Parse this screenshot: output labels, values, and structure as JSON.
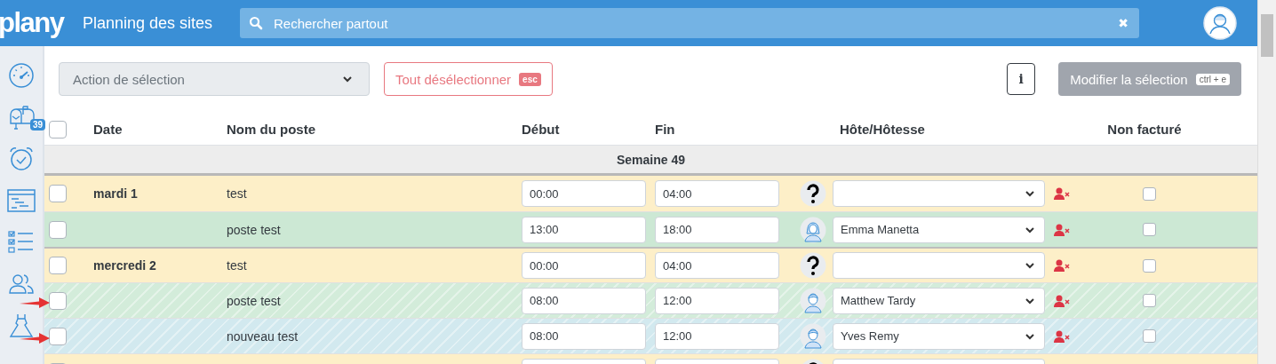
{
  "header": {
    "logo": "plany",
    "title": "Planning des sites",
    "search": {
      "placeholder": "Rechercher partout"
    },
    "clear": "✖"
  },
  "sidebar": {
    "items": [
      {
        "kind": "gauge"
      },
      {
        "kind": "mailbox",
        "badge": "39"
      },
      {
        "kind": "alarm"
      },
      {
        "kind": "window"
      },
      {
        "kind": "checklist"
      },
      {
        "kind": "people"
      },
      {
        "kind": "dress"
      }
    ]
  },
  "toolbar": {
    "action_select": {
      "placeholder": "Action de sélection"
    },
    "deselect": {
      "label": "Tout désélectionner",
      "shortcut": "esc"
    },
    "info": "i",
    "modify": {
      "label": "Modifier la sélection",
      "shortcut": "ctrl + e",
      "disabled": true
    }
  },
  "table": {
    "columns": [
      "Date",
      "Nom du poste",
      "Début",
      "Fin",
      "Hôte/Hôtesse",
      "Non facturé"
    ],
    "select_all": {
      "checked": false
    },
    "group": "Semaine 49",
    "rows": [
      {
        "date": "mardi 1",
        "name": "test",
        "start": "00:00",
        "end": "04:00",
        "avatar": {
          "kind": "unknown"
        },
        "host": null,
        "color": "#fdefc8",
        "striped": false,
        "checked": false,
        "not_billed": false,
        "arrow": false
      },
      {
        "date": null,
        "name": "poste test",
        "start": "13:00",
        "end": "18:00",
        "avatar": {
          "kind": "female"
        },
        "host": "Emma Manetta",
        "color": "#cce8d4",
        "striped": false,
        "checked": false,
        "not_billed": false,
        "arrow": false
      },
      {
        "date": "mercredi 2",
        "name": "test",
        "start": "00:00",
        "end": "04:00",
        "avatar": {
          "kind": "unknown"
        },
        "host": null,
        "color": "#fdefc8",
        "striped": false,
        "checked": false,
        "not_billed": false,
        "arrow": false
      },
      {
        "date": null,
        "name": "poste test",
        "start": "08:00",
        "end": "12:00",
        "avatar": {
          "kind": "male"
        },
        "host": "Matthew Tardy",
        "color": "#d3ecda",
        "striped": true,
        "checked": false,
        "not_billed": false,
        "arrow": true
      },
      {
        "date": null,
        "name": "nouveau test",
        "start": "08:00",
        "end": "12:00",
        "avatar": {
          "kind": "male"
        },
        "host": "Yves Remy",
        "color": "#d2e9ef",
        "striped": true,
        "checked": false,
        "not_billed": false,
        "arrow": true
      },
      {
        "date": null,
        "name": null,
        "start": null,
        "end": null,
        "avatar": {
          "kind": "unknown"
        },
        "host": null,
        "color": "#fdefc8",
        "striped": false,
        "checked": false
      }
    ]
  }
}
